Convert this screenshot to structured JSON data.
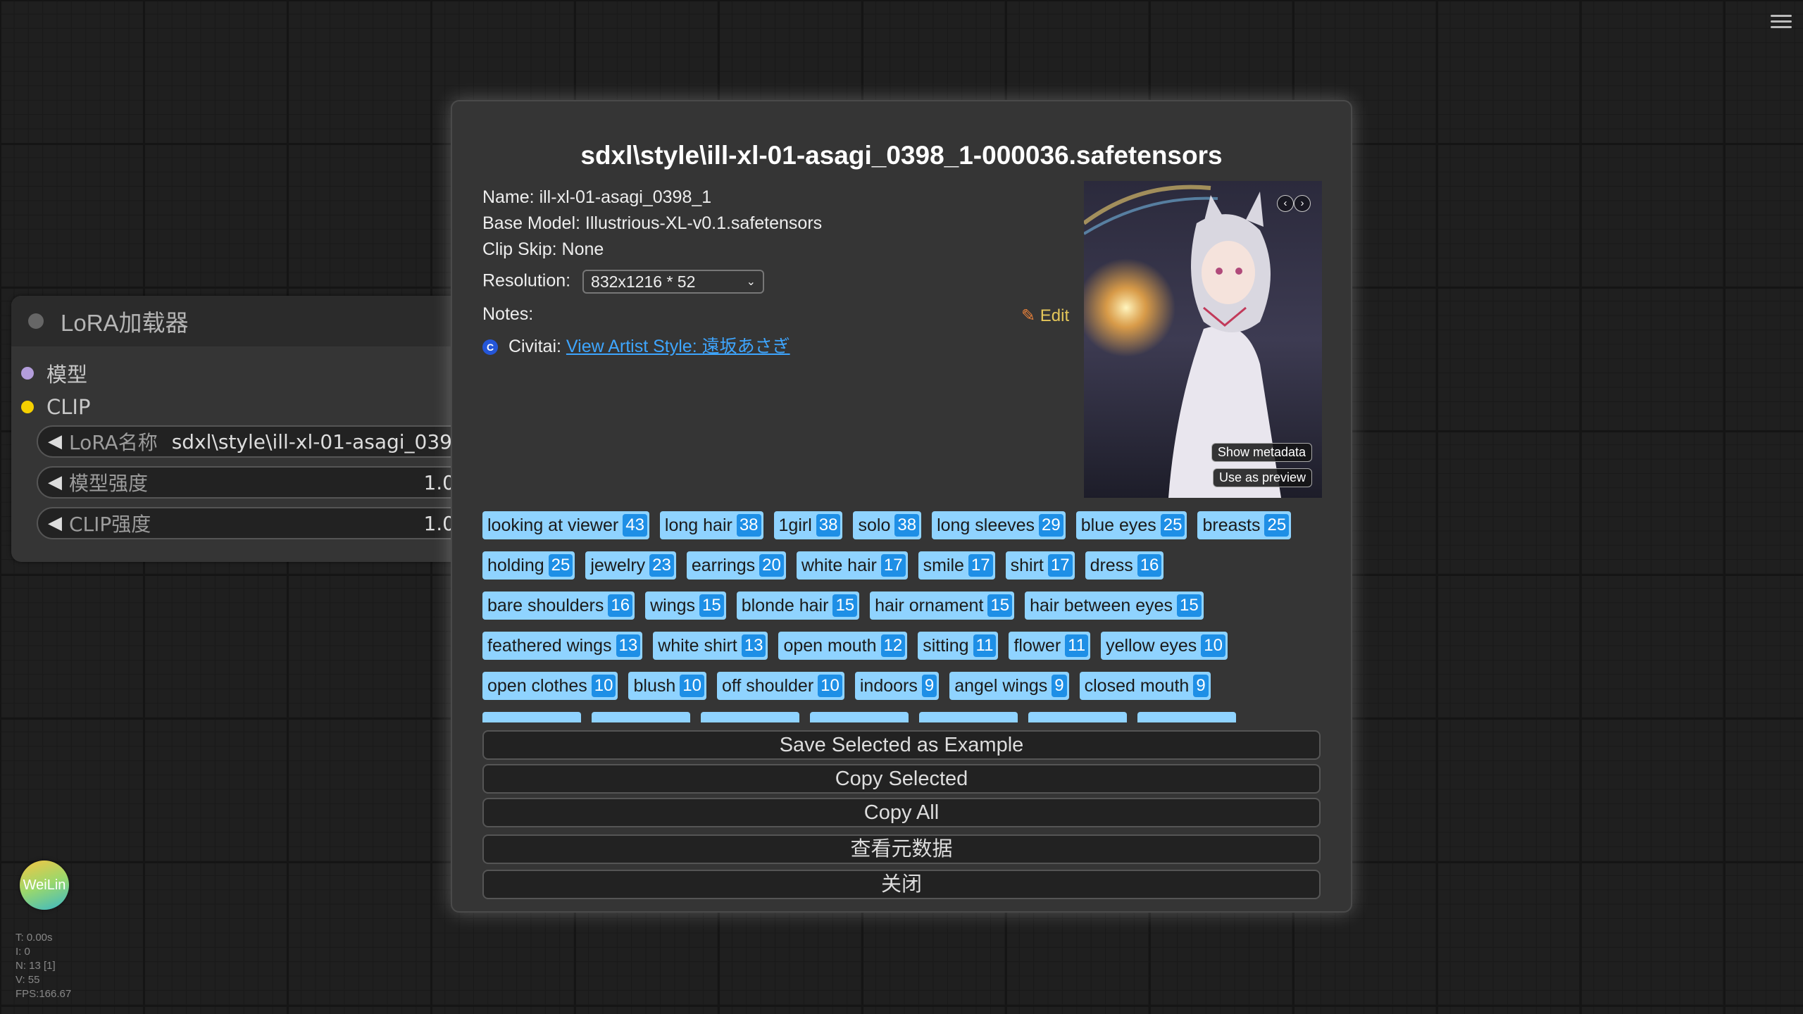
{
  "node": {
    "title": "LoRA加载器",
    "inputs": [
      {
        "label": "模型",
        "color": "#b39ddb"
      },
      {
        "label": "CLIP",
        "color": "#f5d000"
      }
    ],
    "widgets": {
      "lora_name_label": "LoRA名称",
      "lora_name_value": "sdxl\\style\\ill-xl-01-asagi_039...",
      "model_strength_label": "模型强度",
      "model_strength_value": "1.0",
      "clip_strength_label": "CLIP强度",
      "clip_strength_value": "1.0"
    }
  },
  "weilin": {
    "label": "WeiLin"
  },
  "stats": [
    "T: 0.00s",
    "I: 0",
    "N: 13 [1]",
    "V: 55",
    "FPS:166.67"
  ],
  "dialog": {
    "title": "sdxl\\style\\ill-xl-01-asagi_0398_1-000036.safetensors",
    "name": "Name: ill-xl-01-asagi_0398_1",
    "base_model": "Base Model: Illustrious-XL-v0.1.safetensors",
    "clip_skip": "Clip Skip: None",
    "resolution_label": "Resolution:",
    "resolution_value": "832x1216 * 52",
    "notes_label": "Notes:",
    "edit_label": "Edit",
    "civitai_label": "Civitai:",
    "civitai_link": "View Artist Style: 遠坂あさぎ",
    "preview_buttons": {
      "show_metadata": "Show metadata",
      "use_as_preview": "Use as preview"
    },
    "tags": [
      [
        {
          "t": "looking at viewer",
          "c": "43"
        },
        {
          "t": "long hair",
          "c": "38"
        },
        {
          "t": "1girl",
          "c": "38"
        },
        {
          "t": "solo",
          "c": "38"
        },
        {
          "t": "long sleeves",
          "c": "29"
        },
        {
          "t": "blue eyes",
          "c": "25"
        },
        {
          "t": "breasts",
          "c": "25"
        }
      ],
      [
        {
          "t": "holding",
          "c": "25"
        },
        {
          "t": "jewelry",
          "c": "23"
        },
        {
          "t": "earrings",
          "c": "20"
        },
        {
          "t": "white hair",
          "c": "17"
        },
        {
          "t": "smile",
          "c": "17"
        },
        {
          "t": "shirt",
          "c": "17"
        },
        {
          "t": "dress",
          "c": "16"
        }
      ],
      [
        {
          "t": "bare shoulders",
          "c": "16"
        },
        {
          "t": "wings",
          "c": "15"
        },
        {
          "t": "blonde hair",
          "c": "15"
        },
        {
          "t": "hair ornament",
          "c": "15"
        },
        {
          "t": "hair between eyes",
          "c": "15"
        }
      ],
      [
        {
          "t": "feathered wings",
          "c": "13"
        },
        {
          "t": "white shirt",
          "c": "13"
        },
        {
          "t": "open mouth",
          "c": "12"
        },
        {
          "t": "sitting",
          "c": "11"
        },
        {
          "t": "flower",
          "c": "11"
        },
        {
          "t": "yellow eyes",
          "c": "10"
        }
      ],
      [
        {
          "t": "open clothes",
          "c": "10"
        },
        {
          "t": "blush",
          "c": "10"
        },
        {
          "t": "off shoulder",
          "c": "10"
        },
        {
          "t": "indoors",
          "c": "9"
        },
        {
          "t": "angel wings",
          "c": "9"
        },
        {
          "t": "closed mouth",
          "c": "9"
        }
      ]
    ],
    "actions": [
      "Save Selected as Example",
      "Copy Selected",
      "Copy All",
      "查看元数据",
      "关闭"
    ]
  }
}
